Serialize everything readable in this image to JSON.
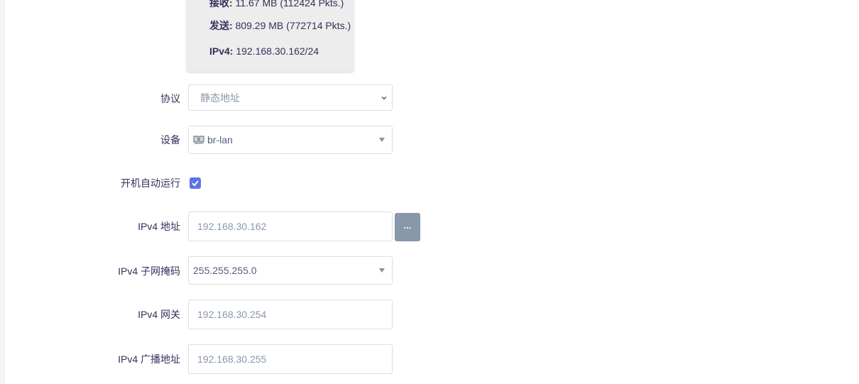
{
  "status": {
    "lines": [
      {
        "key": "接收:",
        "value": "11.67 MB (112424 Pkts.)"
      },
      {
        "key": "发送:",
        "value": "809.29 MB (772714 Pkts.)"
      },
      {
        "key": "IPv4:",
        "value": "192.168.30.162/24"
      }
    ]
  },
  "form": {
    "protocol": {
      "label": "协议",
      "value": "静态地址"
    },
    "device": {
      "label": "设备",
      "value": "br-lan",
      "icon": "network-bridge-icon"
    },
    "autostart": {
      "label": "开机自动运行",
      "checked": true
    },
    "ipv4_address": {
      "label": "IPv4 地址",
      "value": "192.168.30.162",
      "more_label": "..."
    },
    "ipv4_netmask": {
      "label": "IPv4 子网掩码",
      "value": "255.255.255.0"
    },
    "ipv4_gateway": {
      "label": "IPv4 网关",
      "value": "192.168.30.254"
    },
    "ipv4_broadcast": {
      "label": "IPv4 广播地址",
      "value": "192.168.30.255"
    }
  },
  "colors": {
    "accent": "#5e72e4",
    "text": "#32325d",
    "muted": "#8898aa",
    "card": "#ededed"
  }
}
